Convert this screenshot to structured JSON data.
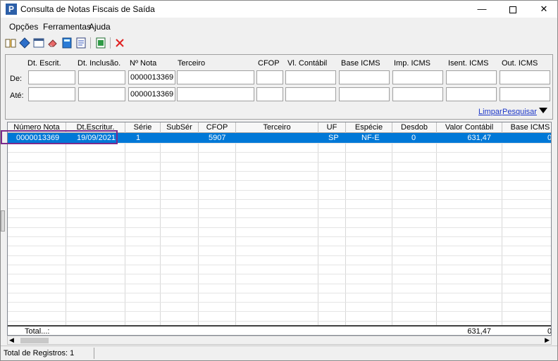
{
  "window": {
    "title": "Consulta de Notas Fiscais de Saída",
    "icon_letter": "P",
    "minimize": "—",
    "close": "✕"
  },
  "menu": [
    "Opções",
    "Ferramentas",
    "Ajuda"
  ],
  "filter": {
    "headers": [
      "Dt. Escrit.",
      "Dt. Inclusão.",
      "Nº Nota",
      "Terceiro",
      "CFOP",
      "Vl. Contábil",
      "Base ICMS",
      "Imp. ICMS",
      "Isent. ICMS",
      "Out. ICMS"
    ],
    "row_de": "De:",
    "row_ate": "Até:",
    "nota_de": "0000013369",
    "nota_ate": "0000013369",
    "limpar": "Limpar",
    "pesquisar": "Pesquisar"
  },
  "grid": {
    "columns": [
      "Número Nota",
      "Dt.Escritur.",
      "Série",
      "SubSér",
      "CFOP",
      "Terceiro",
      "UF",
      "Espécie",
      "Desdob",
      "Valor Contábil",
      "Base ICMS"
    ],
    "row": {
      "numero": "0000013369",
      "data": "19/09/2021",
      "serie": "1",
      "subser": "",
      "cfop": "5907",
      "terceiro": "",
      "uf": "SP",
      "especie": "NF-E",
      "desdob": "0",
      "valor": "631,47",
      "base": "0"
    },
    "total_label": "Total...:",
    "total_valor": "631,47",
    "total_base": "0"
  },
  "status": {
    "text": "Total de Registros: 1"
  },
  "colors": {
    "selection": "#0078d7",
    "focus": "#7b2a8c",
    "link": "#1a35c8"
  }
}
